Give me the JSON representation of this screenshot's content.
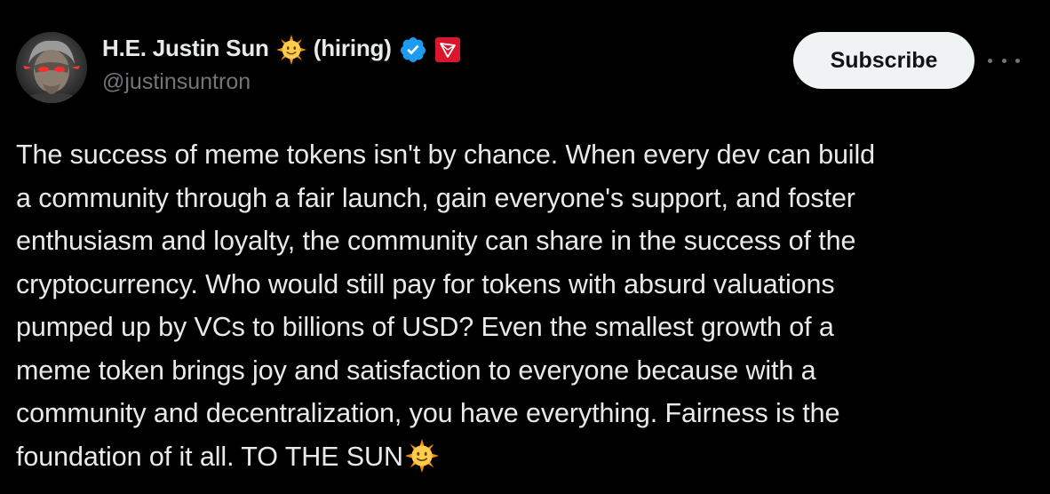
{
  "author": {
    "name_part1": "H.E. Justin Sun",
    "name_part2": "(hiring)",
    "handle": "@justinsuntron"
  },
  "actions": {
    "subscribe_label": "Subscribe"
  },
  "tweet": {
    "lines": [
      "The success of meme tokens isn't by chance. When every dev can build",
      "a community through a fair launch, gain everyone's support, and foster",
      "enthusiasm and loyalty, the community can share in the success of the",
      "cryptocurrency. Who would still pay for tokens with absurd valuations",
      "pumped up by VCs to billions of USD? Even the smallest growth of a",
      "meme token brings joy and satisfaction to everyone because with a",
      "community and decentralization, you have everything. Fairness is the",
      "foundation of it all. TO THE SUN"
    ]
  },
  "icons": {
    "sun": "sun-emoji",
    "verified": "verified-badge-icon",
    "affiliate": "tron-affiliate-icon",
    "more": "more-icon"
  },
  "colors": {
    "background": "#000000",
    "text_primary": "#e7e9ea",
    "text_secondary": "#71767b",
    "verified_blue": "#1d9bf0",
    "button_bg": "#eff3f4",
    "affiliate_red": "#d9162d"
  }
}
